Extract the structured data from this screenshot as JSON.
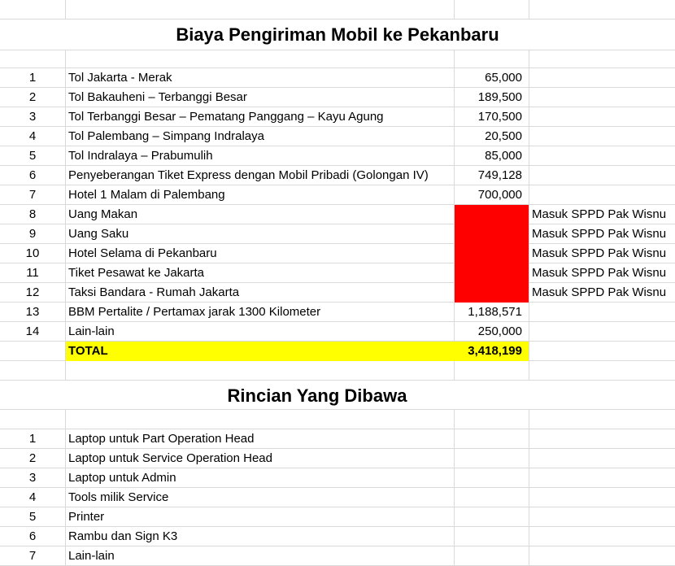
{
  "title": "Biaya Pengiriman Mobil ke Pekanbaru",
  "costs": [
    {
      "no": "1",
      "desc": "Tol Jakarta - Merak",
      "amount": "65,000",
      "note": ""
    },
    {
      "no": "2",
      "desc": "Tol Bakauheni – Terbanggi Besar",
      "amount": "189,500",
      "note": ""
    },
    {
      "no": "3",
      "desc": "Tol Terbanggi Besar – Pematang Panggang – Kayu Agung",
      "amount": "170,500",
      "note": ""
    },
    {
      "no": "4",
      "desc": "Tol Palembang – Simpang Indralaya",
      "amount": "20,500",
      "note": ""
    },
    {
      "no": "5",
      "desc": "Tol Indralaya – Prabumulih",
      "amount": "85,000",
      "note": ""
    },
    {
      "no": "6",
      "desc": "Penyeberangan Tiket Express dengan Mobil Pribadi (Golongan IV)",
      "amount": "749,128",
      "note": ""
    },
    {
      "no": "7",
      "desc": "Hotel 1 Malam di Palembang",
      "amount": "700,000",
      "note": ""
    },
    {
      "no": "8",
      "desc": "Uang Makan",
      "amount": "",
      "note": "Masuk SPPD Pak Wisnu"
    },
    {
      "no": "9",
      "desc": "Uang Saku",
      "amount": "",
      "note": "Masuk SPPD Pak Wisnu"
    },
    {
      "no": "10",
      "desc": "Hotel Selama di Pekanbaru",
      "amount": "",
      "note": "Masuk SPPD Pak Wisnu"
    },
    {
      "no": "11",
      "desc": "Tiket Pesawat ke Jakarta",
      "amount": "",
      "note": "Masuk SPPD Pak Wisnu"
    },
    {
      "no": "12",
      "desc": "Taksi Bandara - Rumah Jakarta",
      "amount": "",
      "note": "Masuk SPPD Pak Wisnu"
    },
    {
      "no": "13",
      "desc": "BBM Pertalite / Pertamax jarak 1300 Kilometer",
      "amount": "1,188,571",
      "note": ""
    },
    {
      "no": "14",
      "desc": "Lain-lain",
      "amount": "250,000",
      "note": ""
    }
  ],
  "total": {
    "label": "TOTAL",
    "amount": "3,418,199"
  },
  "colors": {
    "highlight_red": "#ff0000",
    "highlight_yellow": "#ffff00",
    "gridline": "#d9d9d9"
  },
  "subtitle": "Rincian Yang Dibawa",
  "items": [
    {
      "no": "1",
      "desc": "Laptop untuk Part Operation Head"
    },
    {
      "no": "2",
      "desc": "Laptop untuk Service Operation Head"
    },
    {
      "no": "3",
      "desc": "Laptop untuk Admin"
    },
    {
      "no": "4",
      "desc": "Tools milik Service"
    },
    {
      "no": "5",
      "desc": "Printer"
    },
    {
      "no": "6",
      "desc": "Rambu dan Sign K3"
    },
    {
      "no": "7",
      "desc": "Lain-lain"
    }
  ]
}
